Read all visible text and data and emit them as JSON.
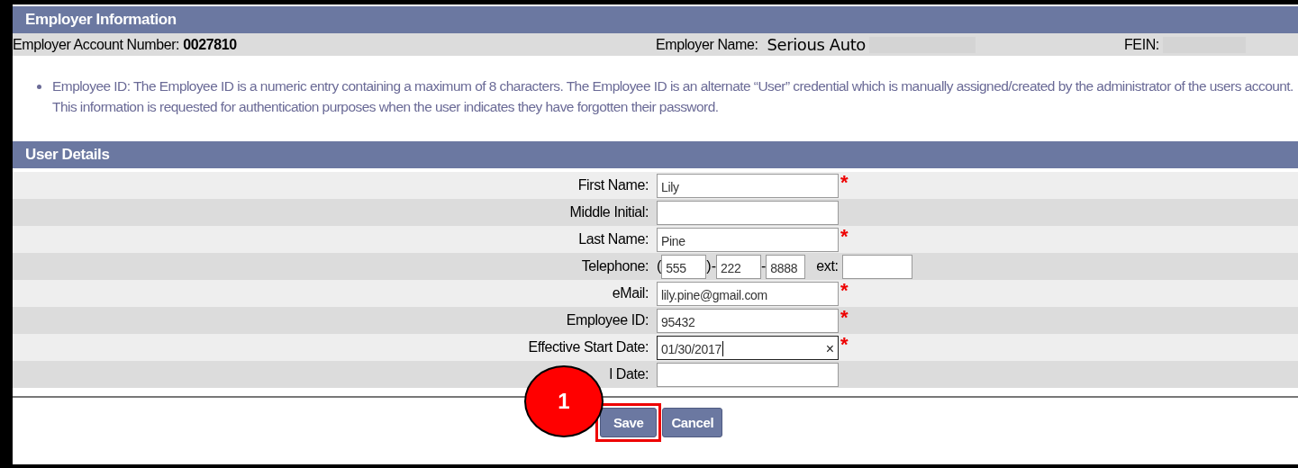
{
  "employer_information": {
    "title": "Employer Information",
    "account_label": "Employer Account Number:",
    "account_number": "0027810",
    "name_label": "Employer Name:",
    "name": "Serious Auto",
    "fein_label": "FEIN:"
  },
  "notes": [
    "Employee ID: The Employee ID is a numeric entry containing a maximum of 8 characters. The Employee ID is an alternate “User” credential which is manually assigned/created by the administrator of the users account. This information is requested for authentication purposes when the user indicates they have forgotten their password."
  ],
  "user_details": {
    "title": "User Details",
    "rows": [
      {
        "kind": "text",
        "label": "First Name:",
        "value": "Lily",
        "required_mark": "*",
        "focused": false
      },
      {
        "kind": "text",
        "label": "Middle Initial:",
        "focused": false
      },
      {
        "kind": "text",
        "label": "Last Name:",
        "value": "Pine",
        "required_mark": "*",
        "focused": false
      },
      {
        "kind": "phone",
        "label": "Telephone:",
        "area": "555",
        "prefix": "222",
        "line": "8888",
        "ext_label": "ext:",
        "open": "(",
        "sep1": ")-",
        "sep2": "-"
      },
      {
        "kind": "text",
        "label": "eMail:",
        "value": "lily.pine@gmail.com",
        "required_mark": "*",
        "focused": false
      },
      {
        "kind": "text",
        "label": "Employee ID:",
        "value": "95432",
        "required_mark": "*",
        "focused": false
      },
      {
        "kind": "date",
        "label": "Effective Start Date:",
        "value": "01/30/2017",
        "required_mark": "*",
        "focused": true,
        "clear": "×"
      },
      {
        "kind": "date",
        "label": "l Date:",
        "focused": false
      }
    ]
  },
  "buttons": [
    {
      "label": "Save",
      "highlighted": true
    },
    {
      "label": "Cancel",
      "highlighted": false
    }
  ],
  "callout": {
    "number": "1"
  }
}
